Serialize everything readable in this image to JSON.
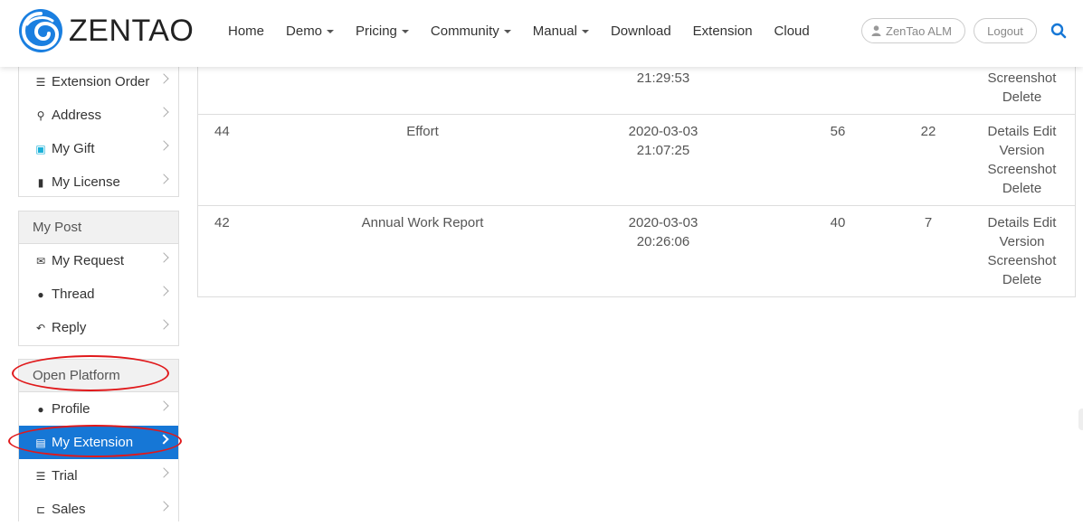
{
  "brand": {
    "name": "ZENTAO"
  },
  "nav": [
    {
      "label": "Home",
      "dropdown": false
    },
    {
      "label": "Demo",
      "dropdown": true
    },
    {
      "label": "Pricing",
      "dropdown": true
    },
    {
      "label": "Community",
      "dropdown": true
    },
    {
      "label": "Manual",
      "dropdown": true
    },
    {
      "label": "Download",
      "dropdown": false
    },
    {
      "label": "Extension",
      "dropdown": false
    },
    {
      "label": "Cloud",
      "dropdown": false
    }
  ],
  "header_buttons": {
    "alm": "ZenTao ALM",
    "logout": "Logout"
  },
  "sidebar": {
    "account_items": [
      {
        "label": "Extension Order",
        "icon": "list-icon"
      },
      {
        "label": "Address",
        "icon": "map-marker-icon"
      },
      {
        "label": "My Gift",
        "icon": "gift-icon"
      },
      {
        "label": "My License",
        "icon": "book-icon"
      }
    ],
    "my_post": {
      "title": "My Post",
      "items": [
        {
          "label": "My Request",
          "icon": "envelope-icon"
        },
        {
          "label": "Thread",
          "icon": "comment-icon"
        },
        {
          "label": "Reply",
          "icon": "reply-icon"
        }
      ]
    },
    "open_platform": {
      "title": "Open Platform",
      "items": [
        {
          "label": "Profile",
          "icon": "user-icon",
          "active": false
        },
        {
          "label": "My Extension",
          "icon": "list-alt-icon",
          "active": true
        },
        {
          "label": "Trial",
          "icon": "list-icon",
          "active": false
        },
        {
          "label": "Sales",
          "icon": "cart-icon",
          "active": false
        }
      ]
    }
  },
  "table": {
    "rows": [
      {
        "id": "",
        "name": "",
        "date": "",
        "time": "21:29:53",
        "n1": "",
        "n2": "",
        "actions_line1": "",
        "actions_line2": [
          "Screenshot",
          "Delete"
        ]
      },
      {
        "id": "44",
        "name": "Effort",
        "date": "2020-03-03",
        "time": "21:07:25",
        "n1": "56",
        "n2": "22",
        "actions_line1": [
          "Details",
          "Edit",
          "Version"
        ],
        "actions_line2": [
          "Screenshot",
          "Delete"
        ]
      },
      {
        "id": "42",
        "name": "Annual Work Report",
        "date": "2020-03-03",
        "time": "20:26:06",
        "n1": "40",
        "n2": "7",
        "actions_line1": [
          "Details",
          "Edit",
          "Version"
        ],
        "actions_line2": [
          "Screenshot",
          "Delete"
        ]
      }
    ]
  },
  "colors": {
    "accent": "#1677d6",
    "annotation": "#e0191b"
  }
}
